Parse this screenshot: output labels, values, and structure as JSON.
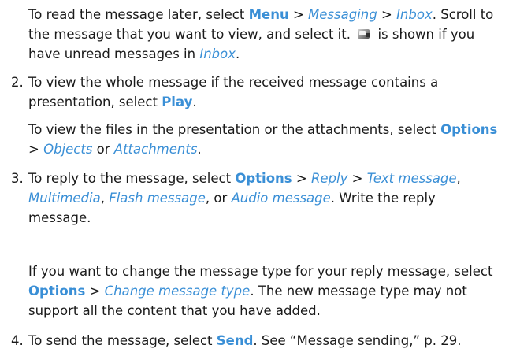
{
  "p1": {
    "t1": "To read the message later, select ",
    "k1": "Menu",
    "sep1": " > ",
    "i1": "Messaging",
    "sep2": " > ",
    "i2": "Inbox",
    "t2": ". Scroll to the message that you want to view, and select it. ",
    "icon": "envelope-icon",
    "t3": " is shown if you have unread messages in ",
    "i3": "Inbox",
    "t4": "."
  },
  "s2": {
    "num": "2.",
    "t1": "To view the whole message if the received message contains a presentation, select ",
    "k1": "Play",
    "t2": "."
  },
  "p2": {
    "t1": "To view the files in the presentation or the attachments, select ",
    "k1": "Options",
    "sep1": " > ",
    "i1": "Objects",
    "t2": " or ",
    "i2": "Attachments",
    "t3": "."
  },
  "s3": {
    "num": "3.",
    "t1": "To reply to the message, select ",
    "k1": "Options",
    "sep1": " > ",
    "i1": "Reply",
    "sep2": " > ",
    "i2": "Text message",
    "c1": ", ",
    "i3": "Multimedia",
    "c2": ", ",
    "i4": "Flash message",
    "c3": ", or ",
    "i5": "Audio message",
    "t2": ". Write the reply message."
  },
  "p3": {
    "t1": "If you want to change the message type for your reply message, select ",
    "k1": "Options",
    "sep1": " > ",
    "i1": "Change message type",
    "t2": ". The new message type may not support all the content that you have added."
  },
  "s4": {
    "num": "4.",
    "t1": "To send the message, select ",
    "k1": "Send",
    "t2": ". See “Message sending,” p. 29."
  }
}
